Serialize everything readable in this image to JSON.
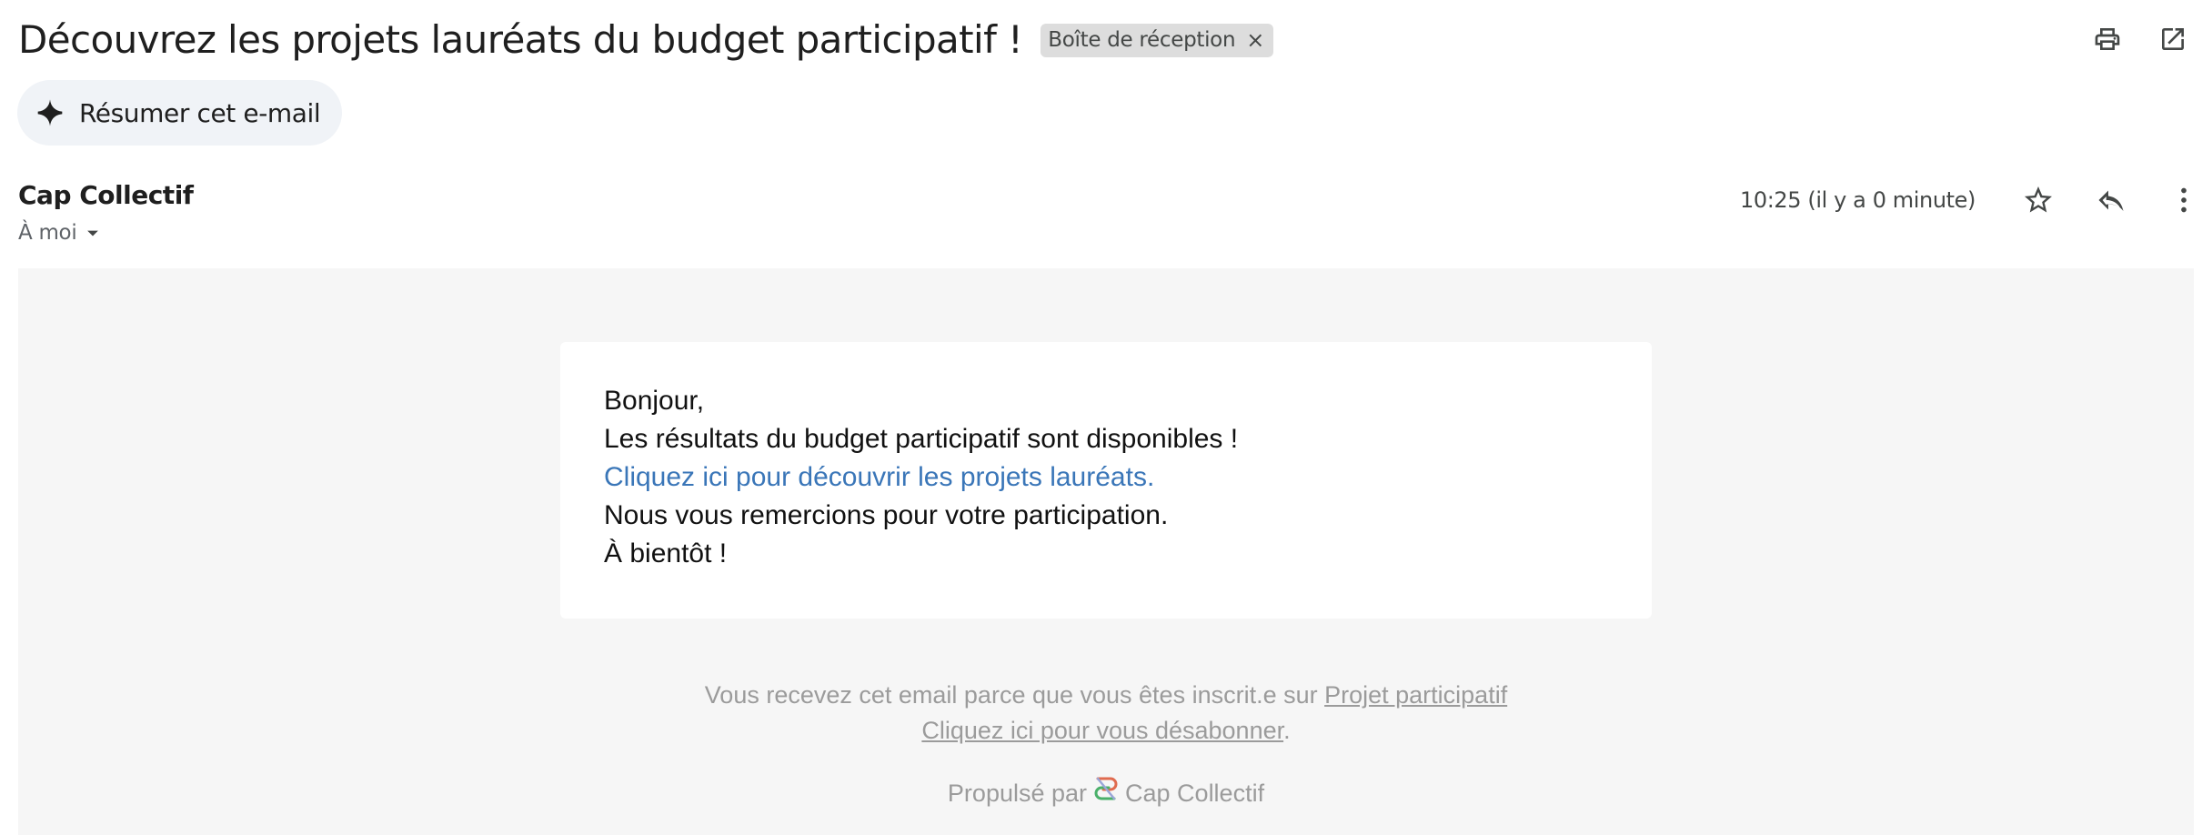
{
  "email": {
    "subject": "Découvrez les projets lauréats du budget participatif !",
    "label_chip": "Boîte de réception",
    "label_chip_close": "×",
    "summarize_label": "Résumer cet e-mail",
    "sender": "Cap Collectif",
    "recipient": "À moi",
    "timestamp": "10:25 (il y a 0 minute)"
  },
  "toolbar": {
    "print_icon": "print-icon",
    "open_new_window_icon": "open-in-new-window-icon",
    "star_icon": "star-icon",
    "reply_icon": "reply-icon",
    "more_icon": "more-vert-icon"
  },
  "body": {
    "greeting": "Bonjour,",
    "line1": "Les résultats du budget participatif sont disponibles !",
    "link_text": "Cliquez ici pour découvrir les projets lauréats.",
    "line2": "Nous vous remercions pour votre participation.",
    "signoff": "À bientôt !"
  },
  "footer": {
    "reason_text": "Vous recevez cet email parce que vous êtes inscrit.e sur ",
    "site_link": "Projet participatif",
    "unsubscribe_link": "Cliquez ici pour vous désabonner",
    "unsubscribe_suffix": ".",
    "powered_by": "Propulsé par",
    "brand": "Cap Collectif"
  },
  "colors": {
    "link": "#3a76b8",
    "body_background": "#f6f6f6",
    "chip_background": "#dddddd",
    "summarize_background": "#f0f3f7",
    "footer_text": "#9b9b9b"
  }
}
